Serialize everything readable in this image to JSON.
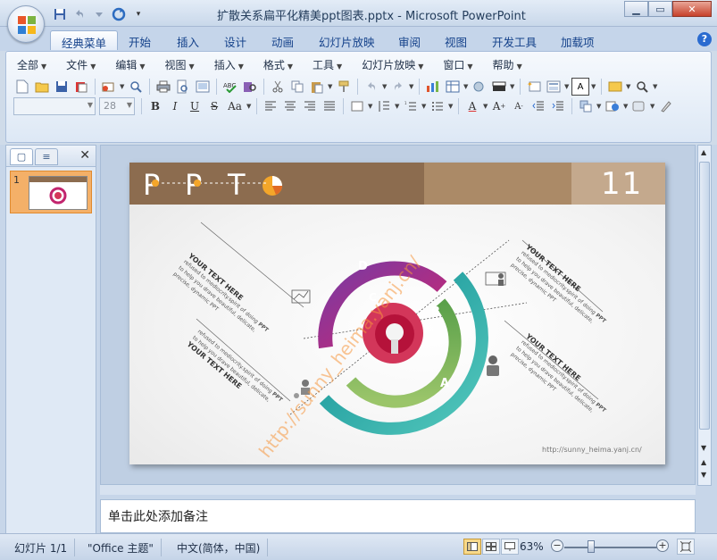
{
  "window": {
    "title": "扩散关系扁平化精美ppt图表.pptx - Microsoft PowerPoint",
    "controls": [
      "minimize",
      "maximize",
      "close"
    ]
  },
  "quick_access": [
    "save-icon",
    "undo-icon",
    "redo-icon",
    "customize-icon"
  ],
  "tabs": [
    {
      "label": "经典菜单",
      "active": true
    },
    {
      "label": "开始"
    },
    {
      "label": "插入"
    },
    {
      "label": "设计"
    },
    {
      "label": "动画"
    },
    {
      "label": "幻灯片放映"
    },
    {
      "label": "审阅"
    },
    {
      "label": "视图"
    },
    {
      "label": "开发工具"
    },
    {
      "label": "加载项"
    }
  ],
  "menubar": [
    "全部",
    "文件",
    "编辑",
    "视图",
    "插入",
    "格式",
    "工具",
    "幻灯片放映",
    "窗口",
    "帮助"
  ],
  "font_size_combo": "28",
  "left_panel": {
    "slide_number": "1"
  },
  "slide": {
    "header_letters": [
      "P",
      "P",
      "T"
    ],
    "slide_number": "11",
    "header_colors": [
      "#8c6c4f",
      "#ab8a67",
      "#c4a98d"
    ],
    "ring_labels": [
      "D",
      "C",
      "B",
      "A"
    ],
    "ring_colors": {
      "D": "#c2256e",
      "C": "#d3365a",
      "B": "#7caf53",
      "A": "#1fa5a0",
      "inner_purple": "#7a3aa2"
    },
    "text_blocks": [
      {
        "heading": "YOUR TEXT HERE",
        "line1": "refused to mediocrity.spirit of doing",
        "bold": "PPT",
        "line2": "to help you drave beautiful, delicate,",
        "line3": "precise, dynamic PPT"
      },
      {
        "heading": "YOUR TEXT HERE",
        "line1": "refused to mediocrity.spirit of doing",
        "bold": "PPT",
        "line2": "to help you drave beautiful, delicate,",
        "line3": ""
      },
      {
        "heading": "YOUR TEXT HERE",
        "line1": "refused to mediocrity.spirit of doing",
        "bold": "PPT",
        "line2": "to help you drave beautiful, delicate,",
        "line3": "precise, dynamic PPT"
      },
      {
        "heading": "YOUR TEXT HERE",
        "line1": "refused to mediocrity.spirit of doing",
        "bold": "PPT",
        "line2": "to help you drave beautiful, delicate,",
        "line3": "precise, dynamic PPT"
      }
    ],
    "watermark": "http://sunny_heima.yanj.cn/",
    "footer_url": "http://sunny_heima.yanj.cn/"
  },
  "notes_placeholder": "单击此处添加备注",
  "statusbar": {
    "slide_info": "幻灯片 1/1",
    "theme": "\"Office 主题\"",
    "language": "中文(简体，中国)",
    "zoom": "63%"
  }
}
